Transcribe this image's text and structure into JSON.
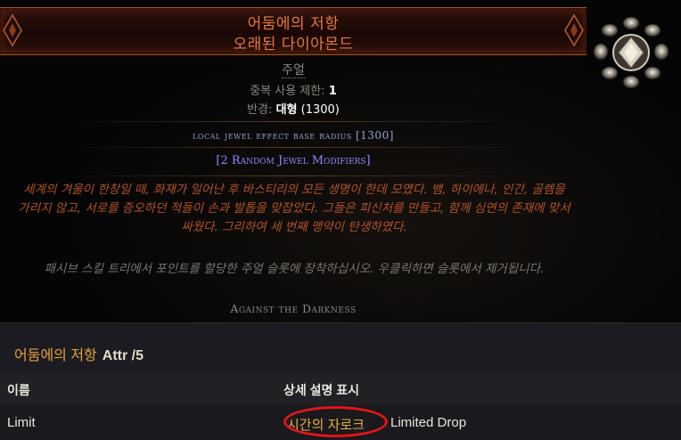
{
  "tooltip": {
    "title_line1": "어둠에의 저항",
    "title_line2": "오래된 다이아몬드",
    "item_class": "주얼",
    "limit_label": "중복 사용 제한:",
    "limit_value": "1",
    "radius_label": "반경:",
    "radius_value": "대형",
    "radius_paren": "(1300)",
    "mod_local": "local jewel effect base radius [1300]",
    "mod_random": "[2 Random Jewel Modifiers]",
    "flavour": "세계의 겨울이 한창일 때, 화재가 일어난 후 바스티리의 모든 생명이 한데 모였다. 뱀, 하이에나, 인간, 골렘을 가리지 않고, 서로를 증오하던 적들이 손과 발톱을 맞잡았다. 그들은 피신처를 만들고, 함께 심연의 존재에 맞서 싸웠다. 그리하여 세 번째 맹약이 탄생하였다.",
    "help_text": "패시브 스킬 트리에서 포인트를 할당한 주얼 슬롯에 장착하십시오. 우클릭하면 슬롯에서 제거됩니다.",
    "against": "Against the Darkness",
    "icon": "jewel-diamond-icon"
  },
  "panel": {
    "title": "어둠에의 저항",
    "attr": "Attr /5",
    "col_name": "이름",
    "col_detail": "상세 설명 표시",
    "row_name": "Limit",
    "row_gold": "시간의 자로크",
    "row_rest": "Limited Drop"
  },
  "colors": {
    "title": "#e6783a",
    "flavour": "#b35226",
    "mod_magic": "#8c8aff",
    "annotation": "#e41515"
  }
}
